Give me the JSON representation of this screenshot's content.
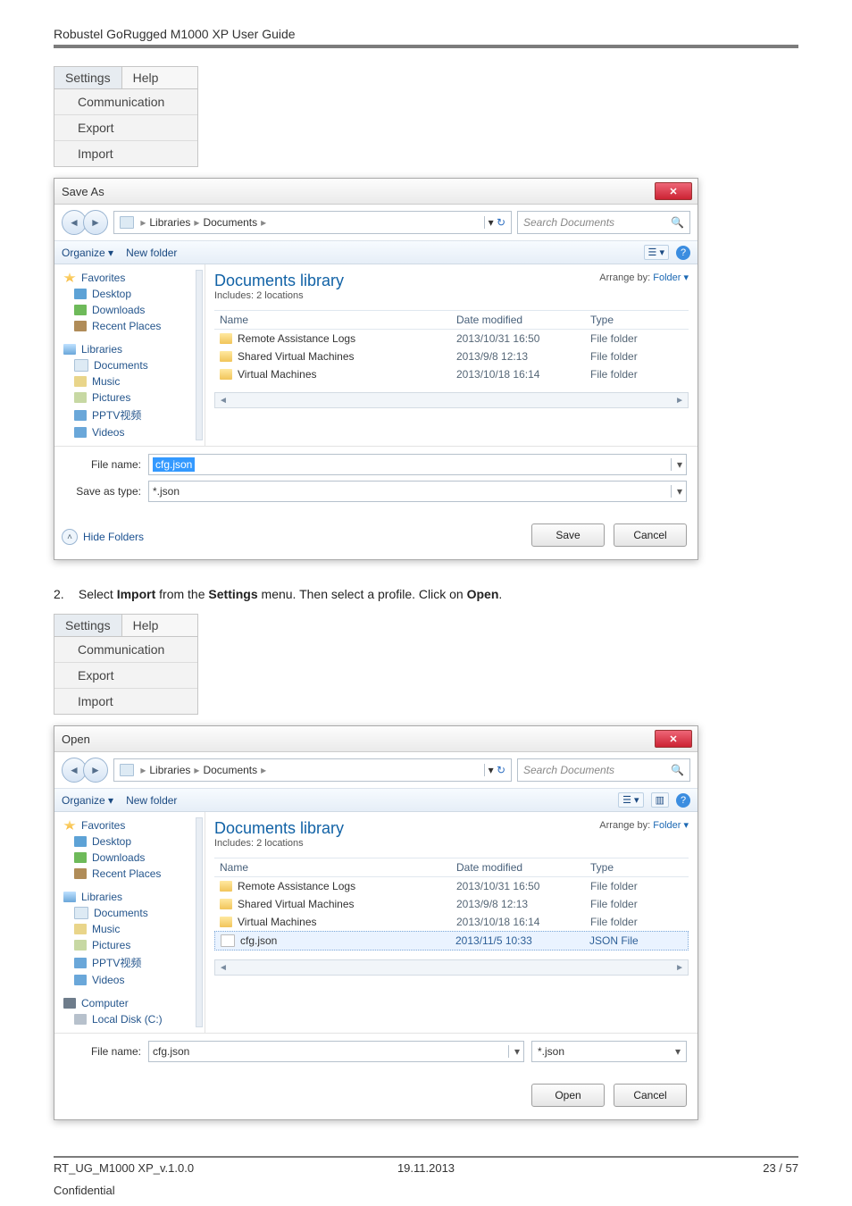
{
  "document": {
    "header_text": "Robustel GoRugged M1000 XP User Guide",
    "step_2": "Select Import from the Settings menu. Then select a profile. Click on Open.",
    "step_num": "2.",
    "step_bold_1": "Import",
    "step_bold_2": "Settings",
    "step_bold_3": "Open"
  },
  "menu": {
    "settings": "Settings",
    "help": "Help",
    "items": [
      "Communication",
      "Export",
      "Import"
    ]
  },
  "saveDialog": {
    "title": "Save As",
    "breadcrumb": {
      "a": "Libraries",
      "b": "Documents",
      "sep": "▸"
    },
    "searchPlaceholder": "Search Documents",
    "organize": "Organize ▾",
    "newfolder": "New folder",
    "viewGlyph": "☰ ▾",
    "nav": {
      "favorites": "Favorites",
      "desktop": "Desktop",
      "downloads": "Downloads",
      "recent": "Recent Places",
      "libraries": "Libraries",
      "documents": "Documents",
      "music": "Music",
      "pictures": "Pictures",
      "pptv": "PPTV视频",
      "videos": "Videos"
    },
    "libHeader": "Documents library",
    "libSub": "Includes: 2 locations",
    "arrangeBy": "Arrange by:",
    "arrangeVal": "Folder ▾",
    "columns": {
      "name": "Name",
      "date": "Date modified",
      "type": "Type"
    },
    "rows": [
      {
        "name": "Remote Assistance Logs",
        "date": "2013/10/31 16:50",
        "type": "File folder"
      },
      {
        "name": "Shared Virtual Machines",
        "date": "2013/9/8 12:13",
        "type": "File folder"
      },
      {
        "name": "Virtual Machines",
        "date": "2013/10/18 16:14",
        "type": "File folder"
      }
    ],
    "fileNameLabel": "File name:",
    "fileNameValue": "cfg.json",
    "saveTypeLabel": "Save as type:",
    "saveTypeValue": "*.json",
    "hideFolders": "Hide Folders",
    "saveBtn": "Save",
    "cancelBtn": "Cancel"
  },
  "openDialog": {
    "title": "Open",
    "breadcrumb": {
      "a": "Libraries",
      "b": "Documents",
      "sep": "▸"
    },
    "searchPlaceholder": "Search Documents",
    "organize": "Organize ▾",
    "newfolder": "New folder",
    "viewGlyph": "☰ ▾",
    "nav": {
      "favorites": "Favorites",
      "desktop": "Desktop",
      "downloads": "Downloads",
      "recent": "Recent Places",
      "libraries": "Libraries",
      "documents": "Documents",
      "music": "Music",
      "pictures": "Pictures",
      "pptv": "PPTV视频",
      "videos": "Videos",
      "computer": "Computer",
      "localdisk": "Local Disk (C:)"
    },
    "libHeader": "Documents library",
    "libSub": "Includes: 2 locations",
    "arrangeBy": "Arrange by:",
    "arrangeVal": "Folder ▾",
    "columns": {
      "name": "Name",
      "date": "Date modified",
      "type": "Type"
    },
    "rows": [
      {
        "name": "Remote Assistance Logs",
        "date": "2013/10/31 16:50",
        "type": "File folder"
      },
      {
        "name": "Shared Virtual Machines",
        "date": "2013/9/8 12:13",
        "type": "File folder"
      },
      {
        "name": "Virtual Machines",
        "date": "2013/10/18 16:14",
        "type": "File folder"
      },
      {
        "name": "cfg.json",
        "date": "2013/11/5 10:33",
        "type": "JSON File",
        "selected": true,
        "json": true
      }
    ],
    "fileNameLabel": "File name:",
    "fileNameValue": "cfg.json",
    "filterValue": "*.json",
    "openBtn": "Open",
    "cancelBtn": "Cancel"
  },
  "footer": {
    "left1": "RT_UG_M1000 XP_v.1.0.0",
    "left2": "Confidential",
    "center": "19.11.2013",
    "right": "23 / 57"
  }
}
